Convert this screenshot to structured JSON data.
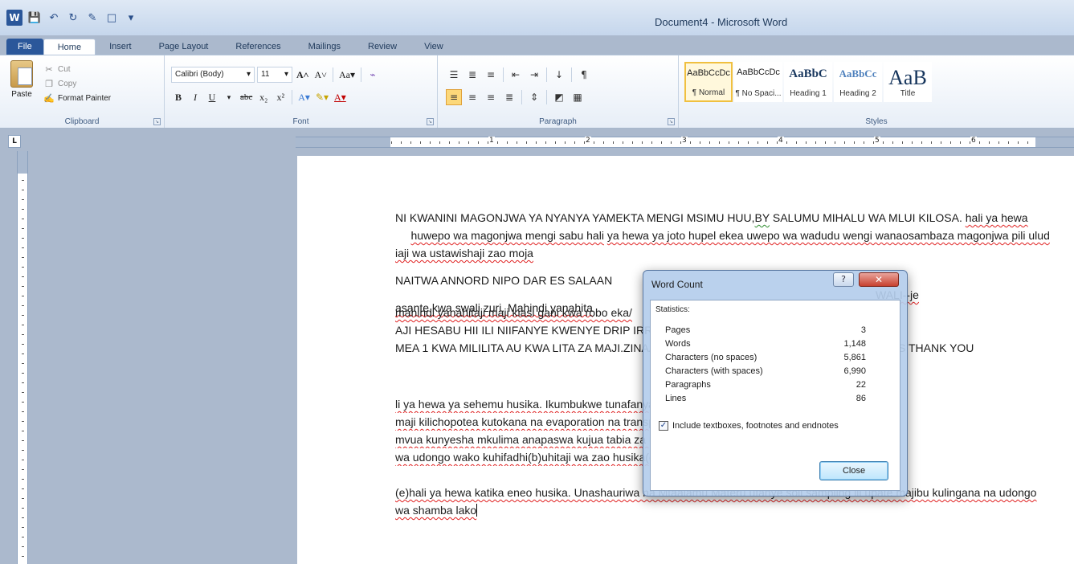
{
  "window": {
    "title": "Document4 - Microsoft Word"
  },
  "tabs": [
    "File",
    "Home",
    "Insert",
    "Page Layout",
    "References",
    "Mailings",
    "Review",
    "View"
  ],
  "clipboard": {
    "paste": "Paste",
    "cut": "Cut",
    "copy": "Copy",
    "format_painter": "Format Painter",
    "label": "Clipboard"
  },
  "font": {
    "family": "Calibri (Body)",
    "size": "11",
    "label": "Font"
  },
  "paragraph": {
    "label": "Paragraph"
  },
  "styles": {
    "label": "Styles",
    "items": [
      {
        "sample": "AaBbCcDc",
        "name": "¶ Normal"
      },
      {
        "sample": "AaBbCcDc",
        "name": "¶ No Spaci..."
      },
      {
        "sample": "AaBbC",
        "name": "Heading 1"
      },
      {
        "sample": "AaBbCc",
        "name": "Heading 2"
      },
      {
        "sample": "AaB",
        "name": "Title"
      }
    ]
  },
  "ruler": {
    "numbers": [
      "1",
      "2",
      "3",
      "4",
      "5",
      "6"
    ]
  },
  "document": {
    "p1": {
      "a": "NI KWANINI MAGONJWA YA NYANYA YAMEKTA MENGI MSIMU HUU,",
      "b": "BY",
      "c": " SALUMU MIHALU WA MLUI KILOSA. ",
      "d": "hali ya hewa",
      "e": "     ",
      "f": "huwepo wa magonjwa mengi sabu hali",
      "g": " ",
      "h": "ya hewa ya joto hupel ekea uwepo wa wadudu wengi wanaosambaza magonjwa pili ulud iaji wa ustawishaji zao moja"
    },
    "p2": {
      "a": "NAITWA ANNORD NIPO DAR ES SALAAN",
      "b": "WALI--je ",
      "c": "mahindi yanahitaji maji kiasi gani kwa robo eka/",
      "d": "AJI HESABU HII ILI NIIFANYE KWENYE DRIP IRRIGATION.KV",
      "e": "MEA 1 KWA MILILITA AU KWA LITA ZA MAJI.ZINAANDIKWA KA",
      "f": "OLES THANK YOU"
    },
    "p3": {
      "a": "asante kwa swali zuri. Mahindi yanahita",
      "b": "li ya hewa ya sehemu husika. Ikumbukwe tunafanya u",
      "c": "maji kilichopotea kutokana na evaporation na transpiratio",
      "d": "mvua kunyesha mkulima anapaswa kujua tabia za udong",
      "e": "wa udongo wako kuhifadhi(b)uhitaji wa zao husika(c)uwe",
      "f": "(e)hali ya hewa katika eneo husika. Unashauriwa na Mtaalamu Materu ufanye soil sampling ili upate majibu kulingana na udongo wa shamba lako"
    }
  },
  "dialog": {
    "title": "Word Count",
    "statistics_label": "Statistics:",
    "stats": [
      {
        "label": "Pages",
        "value": "3"
      },
      {
        "label": "Words",
        "value": "1,148"
      },
      {
        "label": "Characters (no spaces)",
        "value": "5,861"
      },
      {
        "label": "Characters (with spaces)",
        "value": "6,990"
      },
      {
        "label": "Paragraphs",
        "value": "22"
      },
      {
        "label": "Lines",
        "value": "86"
      }
    ],
    "include_label": "Include textboxes, footnotes and endnotes",
    "include_checked": true,
    "close_label": "Close"
  }
}
